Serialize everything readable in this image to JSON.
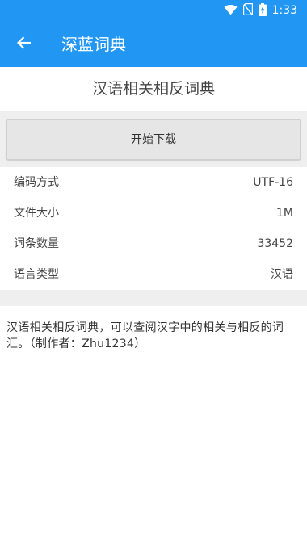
{
  "status_bar": {
    "time": "1:33",
    "icons": [
      "wifi-icon",
      "no-sim-icon",
      "battery-charging-icon"
    ]
  },
  "app_bar": {
    "title": "深蓝词典",
    "back_icon": "arrow-left-icon"
  },
  "dictionary": {
    "title": "汉语相关相反词典",
    "download_label": "开始下载",
    "info": [
      {
        "label": "编码方式",
        "value": "UTF-16"
      },
      {
        "label": "文件大小",
        "value": "1M"
      },
      {
        "label": "词条数量",
        "value": "33452"
      },
      {
        "label": "语言类型",
        "value": "汉语"
      }
    ],
    "description": "汉语相关相反词典，可以查阅汉字中的相关与相反的词汇。（制作者：Zhu1234）"
  },
  "colors": {
    "primary": "#2196f3",
    "band": "#efefef",
    "button": "#e6e6e6"
  }
}
